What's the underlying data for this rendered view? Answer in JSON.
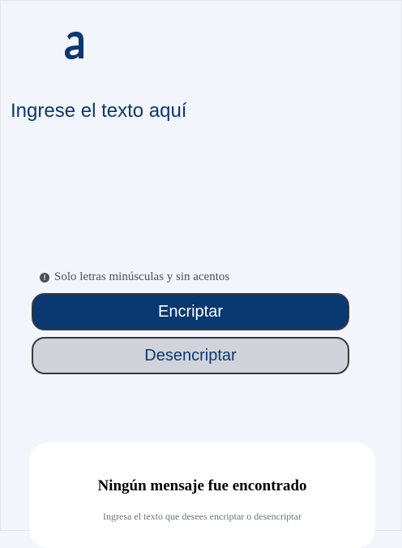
{
  "logo": {
    "icon": "alura-logo-icon",
    "color": "#0a3871"
  },
  "input": {
    "placeholder": "Ingrese el texto aquí",
    "value": ""
  },
  "hint": {
    "icon": "exclamation-circle-icon",
    "text": "Solo letras minúsculas y sin acentos"
  },
  "buttons": {
    "encrypt_label": "Encriptar",
    "decrypt_label": "Desencriptar"
  },
  "output": {
    "title": "Ningún mensaje fue encontrado",
    "subtitle": "Ingresa el texto que desees encriptar o desencriptar"
  },
  "colors": {
    "background": "#f3f5fc",
    "primary": "#0a3871",
    "secondary": "#d0d3d9",
    "card": "#ffffff"
  }
}
